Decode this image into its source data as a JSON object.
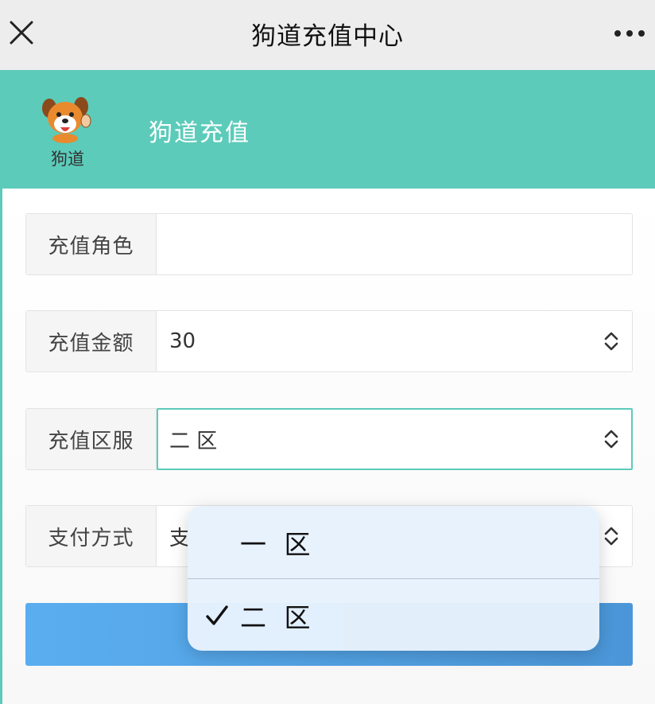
{
  "titlebar": {
    "title": "狗道充值中心"
  },
  "header": {
    "logo_text": "狗道",
    "title": "狗道充值"
  },
  "form": {
    "role": {
      "label": "充值角色",
      "value": ""
    },
    "amount": {
      "label": "充值金额",
      "value": "30"
    },
    "server": {
      "label": "充值区服",
      "value": "二 区"
    },
    "payment": {
      "label": "支付方式",
      "value": "支"
    }
  },
  "picker": {
    "options": [
      {
        "label": "一 区",
        "selected": false
      },
      {
        "label": "二 区",
        "selected": true
      }
    ]
  },
  "colors": {
    "accent": "#5ccbba",
    "button": "#4b96d8"
  }
}
